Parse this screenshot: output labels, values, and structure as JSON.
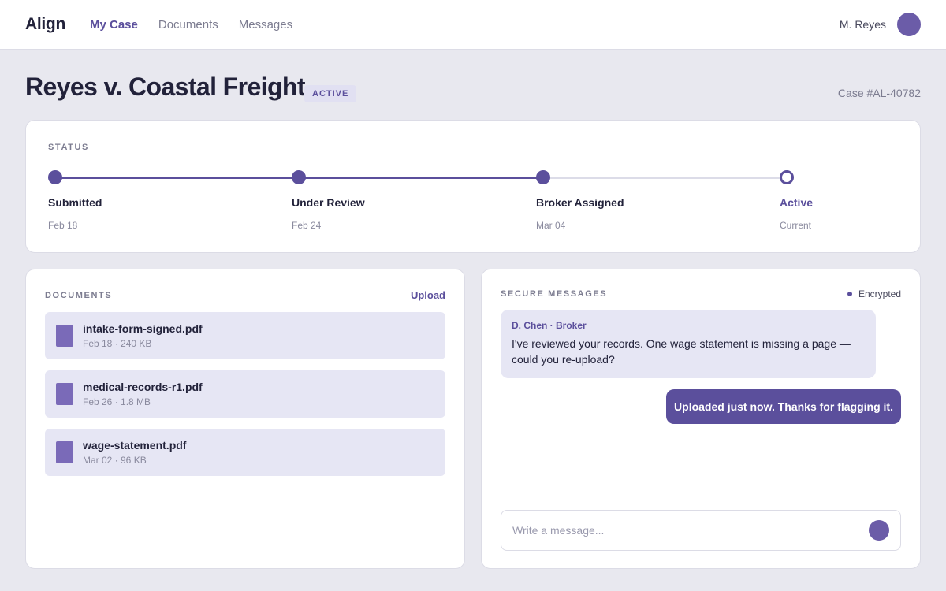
{
  "app": {
    "name": "Align",
    "nav": [
      "My Case",
      "Documents",
      "Messages"
    ],
    "active_nav": "My Case",
    "user_name": "M. Reyes"
  },
  "case": {
    "title": "Reyes v. Coastal Freight",
    "status_badge": "ACTIVE",
    "case_number": "Case #AL-40782"
  },
  "status": {
    "label": "STATUS",
    "steps": [
      {
        "label": "Submitted",
        "date": "Feb 18",
        "state": "done"
      },
      {
        "label": "Under Review",
        "date": "Feb 24",
        "state": "done"
      },
      {
        "label": "Broker Assigned",
        "date": "Mar 04",
        "state": "done"
      },
      {
        "label": "Active",
        "date": "Current",
        "state": "current"
      }
    ]
  },
  "documents": {
    "label": "DOCUMENTS",
    "upload_label": "Upload",
    "items": [
      {
        "name": "intake-form-signed.pdf",
        "meta": "Feb 18 · 240 KB"
      },
      {
        "name": "medical-records-r1.pdf",
        "meta": "Feb 26 · 1.8 MB"
      },
      {
        "name": "wage-statement.pdf",
        "meta": "Mar 02 · 96 KB"
      }
    ]
  },
  "messages": {
    "label": "SECURE MESSAGES",
    "encrypted_label": "Encrypted",
    "thread": [
      {
        "sender": "D. Chen · Broker",
        "text": "I've reviewed your records. One wage statement is missing a page — could you re-upload?"
      },
      {
        "text": "Uploaded just now. Thanks for flagging it."
      }
    ],
    "composer_placeholder": "Write a message..."
  },
  "colors": {
    "accent": "#5b4f9c",
    "background": "#e8e8ef",
    "surface": "#ffffff",
    "doc_tile": "#e6e6f4"
  }
}
